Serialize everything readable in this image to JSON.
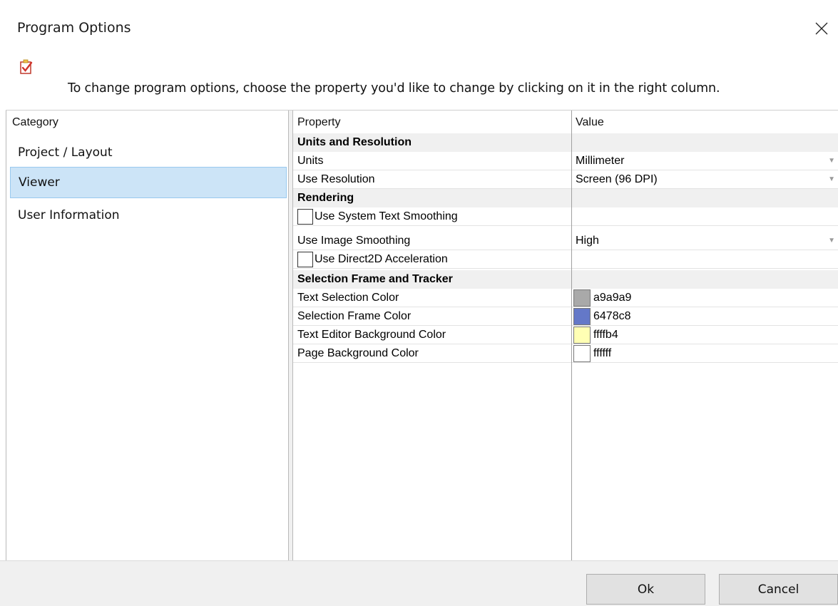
{
  "window": {
    "title": "Program Options"
  },
  "instruction": "To change program options, choose the property you'd like to change by clicking on it in the right column.",
  "categories": {
    "header": "Category",
    "items": [
      {
        "label": "Project / Layout"
      },
      {
        "label": "Viewer"
      },
      {
        "label": "User Information"
      }
    ],
    "selected": "Viewer"
  },
  "grid": {
    "header_property": "Property",
    "header_value": "Value",
    "sections": [
      {
        "title": "Units and Resolution"
      },
      {
        "title": "Rendering"
      },
      {
        "title": "Selection Frame and Tracker"
      }
    ],
    "rows": [
      {
        "property": "Units",
        "value": "Millimeter"
      },
      {
        "property": "Use Resolution",
        "value": "Screen (96 DPI)"
      },
      {
        "property": "Use System Text Smoothing",
        "checked": false
      },
      {
        "property": "Use Image Smoothing",
        "value": "High"
      },
      {
        "property": "Use Direct2D Acceleration",
        "checked": false
      },
      {
        "property": "Text Selection Color",
        "value": "a9a9a9",
        "color": "#a9a9a9"
      },
      {
        "property": "Selection Frame Color",
        "value": "6478c8",
        "color": "#6478c8"
      },
      {
        "property": "Text Editor Background Color",
        "value": "ffffb4",
        "color": "#ffffb4"
      },
      {
        "property": "Page Background Color",
        "value": "ffffff",
        "color": "#ffffff"
      }
    ]
  },
  "buttons": {
    "ok": "Ok",
    "cancel": "Cancel"
  },
  "icons": {
    "close": "close-icon",
    "options": "checklist-icon",
    "dropdown": "dropdown-arrow-icon"
  }
}
